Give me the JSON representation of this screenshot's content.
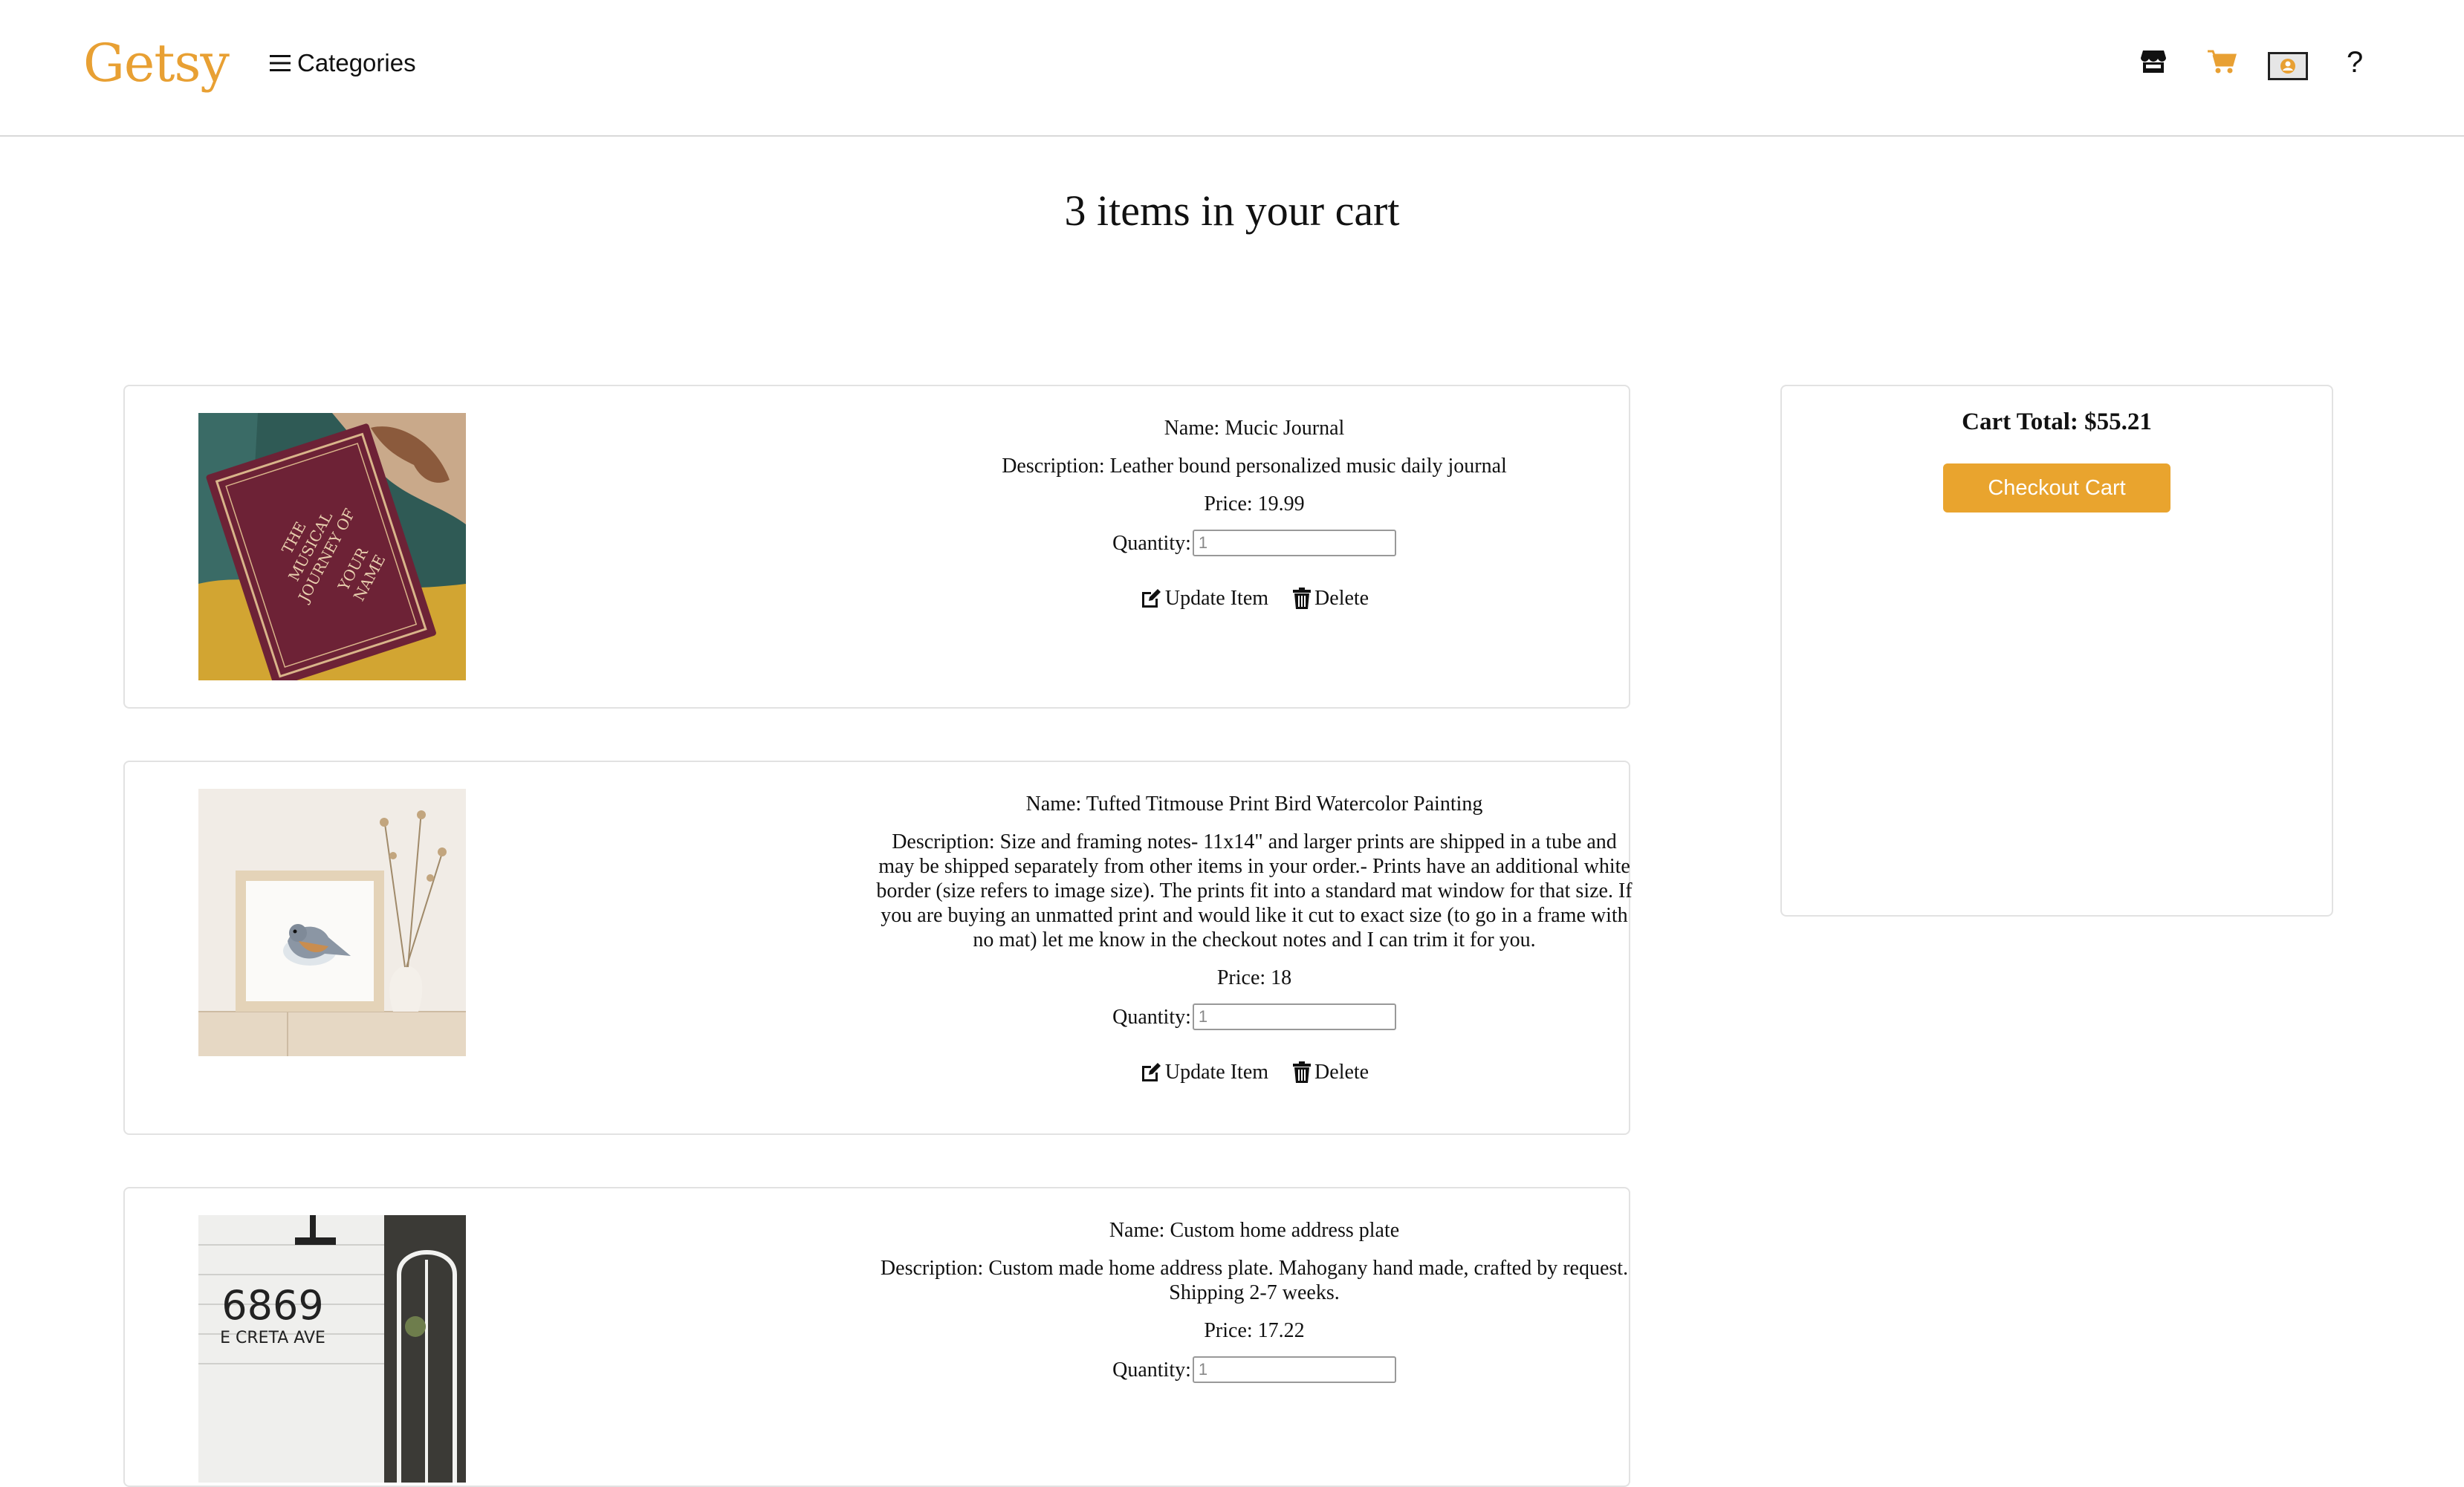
{
  "header": {
    "logo": "Getsy",
    "categories_label": "Categories",
    "help_label": "?",
    "icons": [
      "store-icon",
      "cart-icon",
      "profile-icon"
    ],
    "accent": "#e8a033"
  },
  "page": {
    "title": "3 items in your cart"
  },
  "labels": {
    "quantity": "Quantity:",
    "update": "Update Item",
    "delete": "Delete"
  },
  "items": [
    {
      "name": "Name: Mucic Journal",
      "description": "Description: Leather bound personalized music daily journal",
      "price": "Price: 19.99",
      "quantity": "1",
      "image_text": [
        "THE",
        "MUSICAL",
        "JOURNEY OF",
        "YOUR",
        "NAME"
      ]
    },
    {
      "name": "Name: Tufted Titmouse Print Bird Watercolor Painting",
      "description": "Description: Size and framing notes- 11x14\" and larger prints are shipped in a tube and may be shipped separately from other items in your order.- Prints have an additional white border (size refers to image size). The prints fit into a standard mat window for that size. If you are buying an unmatted print and would like it cut to exact size (to go in a frame with no mat) let me know in the checkout notes and I can trim it for you.",
      "price": "Price: 18",
      "quantity": "1"
    },
    {
      "name": "Name: Custom home address plate",
      "description": "Description: Custom made home address plate. Mahogany hand made, crafted by request. Shipping 2-7 weeks.",
      "price": "Price: 17.22",
      "quantity": "1",
      "image_text": [
        "6869",
        "E CRETA AVE"
      ]
    }
  ],
  "summary": {
    "total": "Cart Total: $55.21",
    "checkout_label": "Checkout Cart",
    "button_color": "#e9a42e"
  }
}
